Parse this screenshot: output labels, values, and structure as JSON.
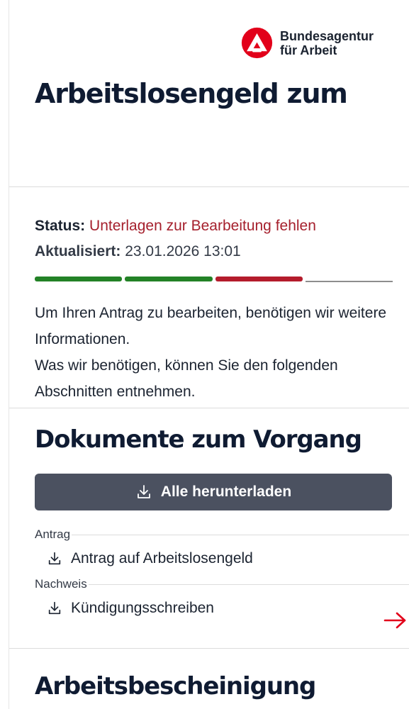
{
  "header": {
    "logo_name": "ba-logo-icon",
    "brand_line1": "Bundesagentur",
    "brand_line2": "für Arbeit",
    "title": "Arbeitslosengeld zum"
  },
  "status": {
    "status_label": "Status:",
    "status_value": "Unterlagen zur Bearbeitung fehlen",
    "updated_label": "Aktualisiert:",
    "updated_value": "23.01.2026 13:01",
    "progress_steps": [
      "done",
      "done",
      "error",
      "open"
    ],
    "text_line1": "Um Ihren Antrag zu bearbeiten, benötigen wir weitere Informationen.",
    "text_line2": "Was wir benötigen, können Sie den folgenden Abschnitten entnehmen.",
    "colors": {
      "done": "#238226",
      "error": "#b41c2c",
      "open": "#8e8e8e",
      "status_text": "#a51f2c"
    }
  },
  "documents": {
    "title": "Dokumente zum Vorgang",
    "download_all_label": "Alle herunterladen",
    "groups": [
      {
        "label": "Antrag",
        "items": [
          "Antrag auf Arbeitslosengeld"
        ]
      },
      {
        "label": "Nachweis",
        "items": [
          "Kündigungsschreiben"
        ]
      }
    ],
    "icons": {
      "download": "download-icon",
      "arrow": "arrow-right-icon"
    }
  },
  "work_certificate": {
    "title": "Arbeitsbescheinigung"
  }
}
